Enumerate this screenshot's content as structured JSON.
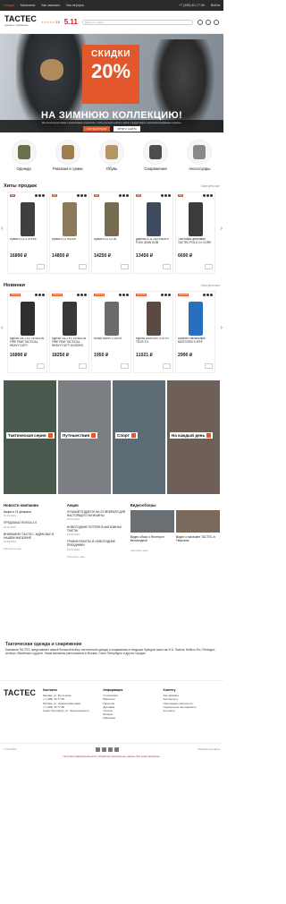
{
  "topbar": {
    "links": [
      "Скидки",
      "Магазины",
      "Как заказать",
      "Как вернуть",
      "Контакты",
      "Доставка",
      "Оплата"
    ],
    "phone": "+7 (495) 40-77-50",
    "account": "Войти",
    "register": "Регистрация"
  },
  "header": {
    "logo": "TACTEC",
    "logo_sub": "одежда и снаряжение",
    "brand": "5.11",
    "search_placeholder": "Поиск по сайту",
    "rating": "4.8",
    "stars": "★★★★★"
  },
  "hero": {
    "sale_line1": "СКИДКИ",
    "sale_line2": "20%",
    "tagline": "НА ЗИМНЮЮ КОЛЛЕКЦИЮ!",
    "cookie_text": "Мы используем cookie и аналогичные технологии, чтобы улучшить работу сайта и предоставить персонализированные сервисы.",
    "cookie_accept": "СОГЛАСИТЬСЯ",
    "cookie_leave": "УЙТИ С САЙТА"
  },
  "categories": [
    {
      "label": "Одежда",
      "color": "#6a7048"
    },
    {
      "label": "Рюкзаки\nи сумки",
      "color": "#a07c4e"
    },
    {
      "label": "Обувь",
      "color": "#b69466"
    },
    {
      "label": "Снаряжение",
      "color": "#4d4d4d"
    },
    {
      "label": "Аксессуары",
      "color": "#888888"
    }
  ],
  "bestsellers": {
    "title": "Хиты продаж",
    "all": "Смотреть все",
    "items": [
      {
        "badge": "Хит",
        "name": "Брюки 5.11 STRYKE",
        "price": "16890 ₽",
        "color": "#3d3f42"
      },
      {
        "badge": "Хит",
        "name": "Брюки 5.11 RIDGE",
        "price": "14850 ₽",
        "color": "#8a7a5a"
      },
      {
        "badge": "Хит",
        "name": "Брюки 5.11 ICON",
        "price": "14250 ₽",
        "color": "#766a50"
      },
      {
        "badge": "Хит",
        "name": "Джинсы 5.11 DEFENDER FLEX JEAN SLIM",
        "price": "13450 ₽",
        "color": "#3e4a5e"
      },
      {
        "badge": "Хит",
        "name": "Толстовка флисовая TACTEC POLS 2.0 CORE",
        "price": "6690 ₽",
        "color": "#3b3b3b"
      }
    ]
  },
  "news_items": {
    "title": "Новинки",
    "all": "Смотреть все",
    "items": [
      {
        "badge": "Новинка",
        "name": "Куртка TACTEC DRAGON FIRE PINE TACTICAL HEAVY DUTY",
        "price": "16890 ₽",
        "color": "#2f2f31"
      },
      {
        "badge": "Новинка",
        "name": "Куртка TACTEC DRAGON FIRE PINE TACTICAL HEAVY DUTY HOODED",
        "price": "18250 ₽",
        "color": "#38383a"
      },
      {
        "badge": "Новинка",
        "name": "Носки DARN TOUGH",
        "price": "1950 ₽",
        "color": "#6b6b6b"
      },
      {
        "badge": "Новинка",
        "name": "Куртка DRAGON TOOTH TKOS 3.0",
        "price": "11021 ₽",
        "color": "#5a4a42"
      },
      {
        "badge": "Новинка",
        "name": "Браслет сигнальный MOSTORCH UTEF",
        "price": "2990 ₽",
        "color": "#2a6fbf"
      }
    ]
  },
  "collage": [
    {
      "label": "Тактическая серия",
      "color": "#4b5a4e"
    },
    {
      "label": "Путешествия",
      "color": "#7b7f83"
    },
    {
      "label": "Спорт",
      "color": "#5d6b74"
    },
    {
      "label": "На каждый день",
      "color": "#6e6058"
    }
  ],
  "company_news": {
    "title": "Новости компании",
    "items": [
      {
        "date": "01.02.2024",
        "text": "Акция в 21 февраля"
      },
      {
        "date": "01.02.2024",
        "text": "ПРЕДЗАКАЗ ROKSA 2.0"
      },
      {
        "date": "01.02.2024",
        "text": "ВНИМАНИЕ! TACTEC. ЖДЕМ ВАС В НАШЕМ МАГАЗИНЕ"
      }
    ],
    "more": "Смотреть еще"
  },
  "promos": {
    "title": "Акции",
    "items": [
      {
        "date": "01.02.2024",
        "text": "ЛУЧШИЙ ПОДАРОК НА 23 ФЕВРАЛЯ ДЛЯ НАСТОЯЩЕГО МУЖЧИНЫ"
      },
      {
        "date": "01.02.2024",
        "text": "НОВОГОДНИЕ ПОТЕРИ В МАГАЗИНАХ ТАКТЭК"
      },
      {
        "date": "01.02.2024",
        "text": "ГРАФИК РАБОТЫ В НОВОГОДНИЕ ПРАЗДНИКИ"
      }
    ],
    "more": "Смотреть еще"
  },
  "videos": {
    "title": "Видеообзоры",
    "items": [
      {
        "text": "Видео обзор о Флотерон Веломодели"
      },
      {
        "text": "Видео о магазине TACTEC в Тверском"
      }
    ],
    "more": "Смотреть еще"
  },
  "seo": {
    "title": "Тактическая одежда и снаряжение",
    "text": "Компания TACTEC представляет самый большой выбор тактической одежды и снаряжения от ведущих брендов таких как 5.11 Tactical, Helikon-Tex, Pentagon, Arcteryx, Blackhawk и других. Наши магазины расположены в Москве, Санкт-Петербурге и других городах."
  },
  "footer": {
    "logo": "TACTEC",
    "contacts_title": "Контакты",
    "contacts": [
      "Москва, ул. Бутлерова",
      "+7 (495) 40-77-50",
      "Москва, ул. Нижняя Масловка",
      "+7 (495) 40-77-50",
      "Санкт-Петербург, ул. Чернышевского"
    ],
    "info_title": "Информация",
    "info": [
      "О компании",
      "Вакансии",
      "Гарантии",
      "Доставка",
      "Оплата",
      "Возврат",
      "Магазины"
    ],
    "client_title": "Клиенту",
    "client": [
      "Как заказать",
      "Как вернуть",
      "Программа лояльности",
      "Подарочные сертификаты",
      "Контакты"
    ]
  },
  "bottom": {
    "copy": "© TACTEC",
    "dev": "Разработка сайта"
  },
  "legal": "Политика конфиденциальности. Обработка персональных данных. Все права защищены."
}
